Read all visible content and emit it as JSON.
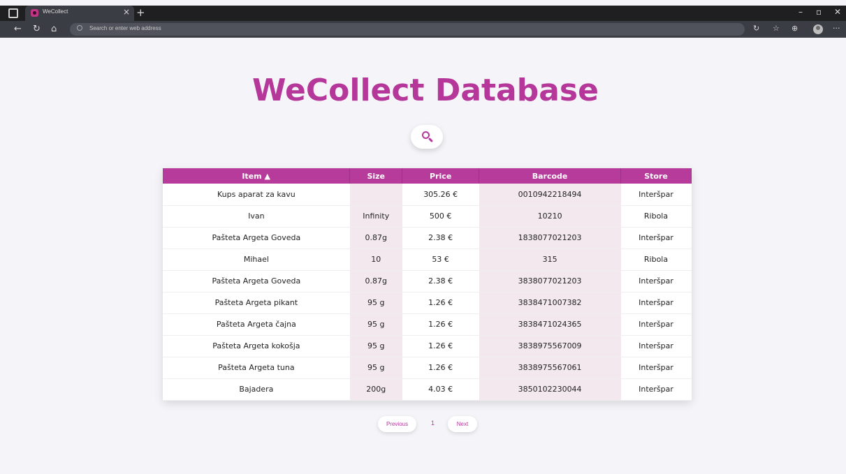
{
  "browser": {
    "tab_title": "WeCollect",
    "tab_close": "×",
    "new_tab": "+",
    "address_placeholder": "Search or enter web address",
    "window_controls": [
      "–",
      "▫",
      "✕"
    ],
    "more": "···"
  },
  "page": {
    "title": "WeCollect Database"
  },
  "table": {
    "headers": {
      "item": "Item ▲",
      "size": "Size",
      "price": "Price",
      "barcode": "Barcode",
      "store": "Store"
    },
    "rows": [
      {
        "item": "Kups aparat za kavu",
        "size": "",
        "price": "305.26 €",
        "barcode": "0010942218494",
        "store": "Interšpar"
      },
      {
        "item": "Ivan",
        "size": "Infinity",
        "price": "500 €",
        "barcode": "10210",
        "store": "Ribola"
      },
      {
        "item": "Pašteta Argeta Goveda",
        "size": "0.87g",
        "price": "2.38 €",
        "barcode": "1838077021203",
        "store": "Interšpar"
      },
      {
        "item": "Mihael",
        "size": "10",
        "price": "53 €",
        "barcode": "315",
        "store": "Ribola"
      },
      {
        "item": "Pašteta Argeta Goveda",
        "size": "0.87g",
        "price": "2.38 €",
        "barcode": "3838077021203",
        "store": "Interšpar"
      },
      {
        "item": "Pašteta Argeta pikant",
        "size": "95 g",
        "price": "1.26 €",
        "barcode": "3838471007382",
        "store": "Interšpar"
      },
      {
        "item": "Pašteta Argeta čajna",
        "size": "95 g",
        "price": "1.26 €",
        "barcode": "3838471024365",
        "store": "Interšpar"
      },
      {
        "item": "Pašteta Argeta kokošja",
        "size": "95 g",
        "price": "1.26 €",
        "barcode": "3838975567009",
        "store": "Interšpar"
      },
      {
        "item": "Pašteta Argeta tuna",
        "size": "95 g",
        "price": "1.26 €",
        "barcode": "3838975567061",
        "store": "Interšpar"
      },
      {
        "item": "Bajadera",
        "size": "200g",
        "price": "4.03 €",
        "barcode": "3850102230044",
        "store": "Interšpar"
      }
    ]
  },
  "pagination": {
    "previous": "Previous",
    "current": "1",
    "next": "Next"
  },
  "colors": {
    "accent": "#b5379a",
    "header_bg": "#b63b9b",
    "shaded_col": "#f3e8ee",
    "page_bg": "#f5f4f8"
  }
}
